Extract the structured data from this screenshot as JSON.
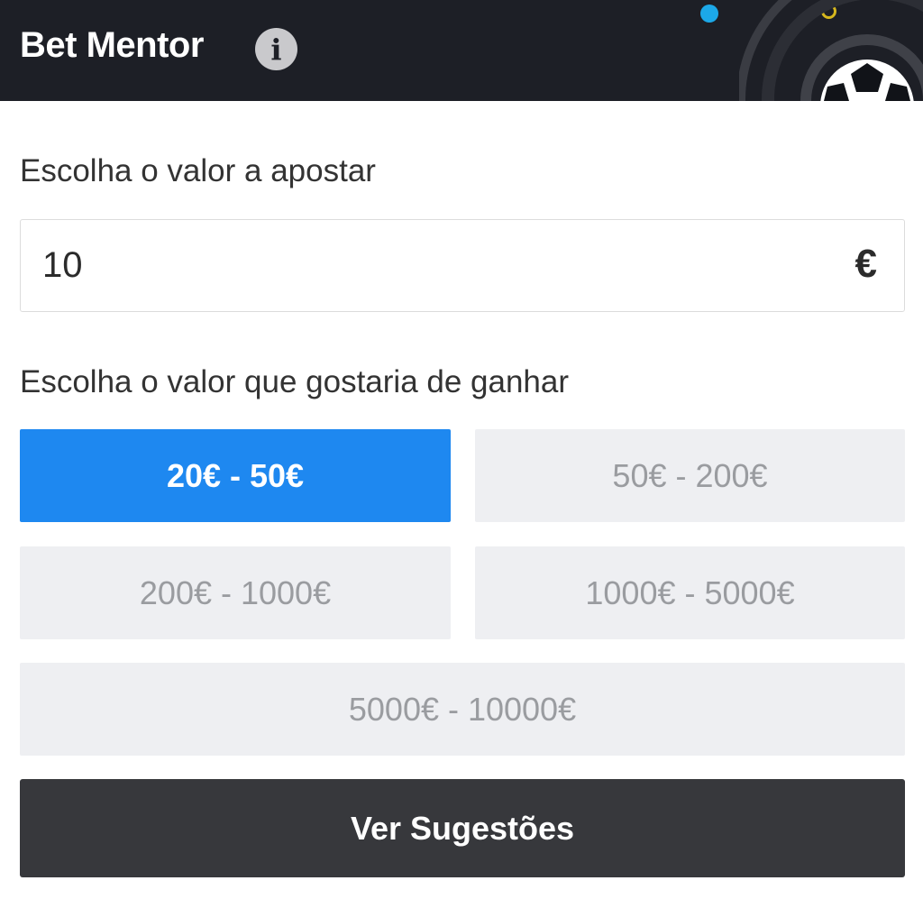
{
  "header": {
    "title": "Bet Mentor",
    "info_icon": "info-icon",
    "decoration": "soccer-ball-icon"
  },
  "stake": {
    "label": "Escolha o valor a apostar",
    "value": "10",
    "currency": "€"
  },
  "win_range": {
    "label": "Escolha o valor que gostaria de ganhar",
    "selected_index": 0,
    "options": [
      "20€ - 50€",
      "50€ - 200€",
      "200€ - 1000€",
      "1000€ - 5000€",
      "5000€ - 10000€"
    ]
  },
  "submit": {
    "label": "Ver Sugestões"
  },
  "colors": {
    "header_bg": "#1d1f26",
    "accent": "#1e88f0",
    "option_bg": "#eeeff2",
    "submit_bg": "#37383c"
  }
}
